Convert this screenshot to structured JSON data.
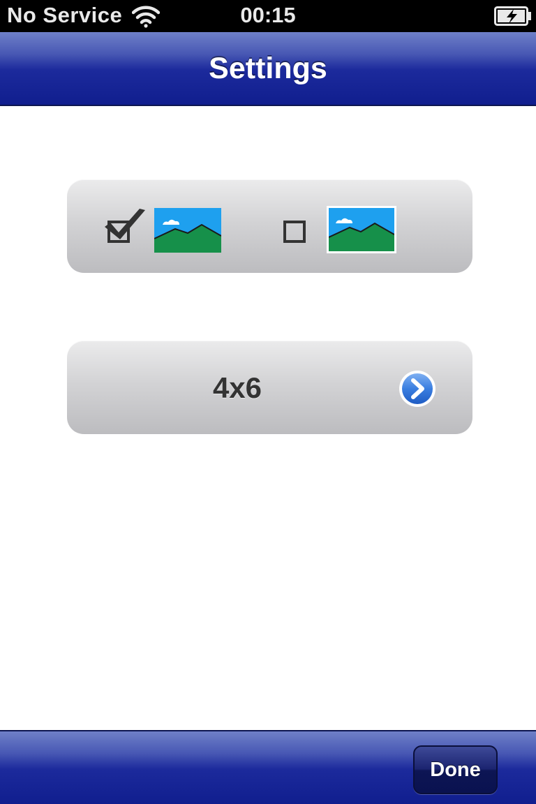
{
  "status_bar": {
    "carrier": "No Service",
    "time": "00:15",
    "wifi_icon": "wifi-icon",
    "battery_icon": "battery-charging-icon"
  },
  "nav_bar": {
    "title": "Settings"
  },
  "orientation_panel": {
    "options": [
      {
        "icon": "landscape-thumbnail-icon",
        "checked": true
      },
      {
        "icon": "landscape-thumbnail-bordered-icon",
        "checked": false
      }
    ]
  },
  "size_panel": {
    "label": "4x6",
    "disclosure_icon": "chevron-right-circle-icon"
  },
  "toolbar": {
    "done_label": "Done"
  },
  "colors": {
    "bar_blue": "#101e8e",
    "bar_blue_light": "#6f80c8",
    "panel_gray": "#d3d3d5",
    "sky": "#1ea0ef",
    "hill": "#16904a",
    "disclosure_blue": "#2c6fd9"
  }
}
